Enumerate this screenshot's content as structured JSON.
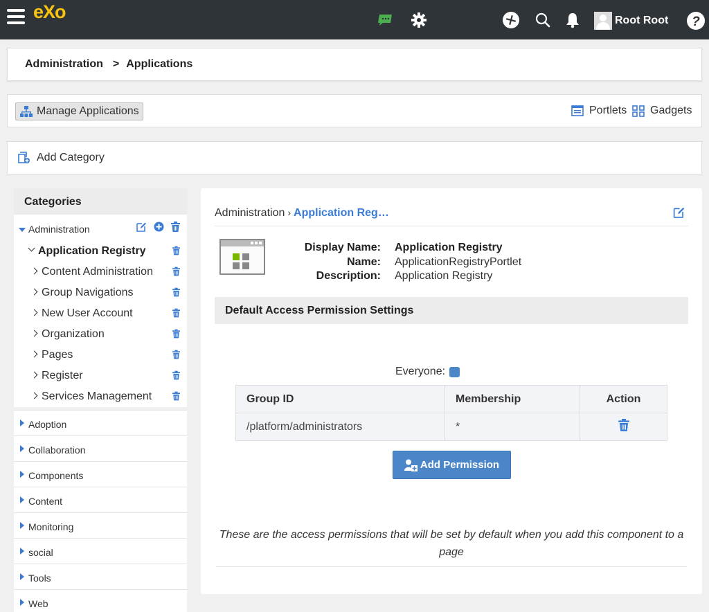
{
  "topbar": {
    "logo": "eXo",
    "user_name": "Root Root",
    "icons": [
      "menu-icon",
      "chat-icon",
      "settings-icon",
      "add-icon",
      "search-icon",
      "notification-icon",
      "help-icon"
    ]
  },
  "breadcrumb": {
    "first": "Administration",
    "separator": ">",
    "second": "Applications"
  },
  "toolbar": {
    "manage_label": "Manage Applications",
    "portlets_label": "Portlets",
    "gadgets_label": "Gadgets"
  },
  "add_category_label": "Add Category",
  "sidebar": {
    "title": "Categories",
    "open_category": "Administration",
    "items": [
      "Application Registry",
      "Content Administration",
      "Group Navigations",
      "New User Account",
      "Organization",
      "Pages",
      "Register",
      "Services Management"
    ],
    "closed_categories": [
      "Adoption",
      "Collaboration",
      "Components",
      "Content",
      "Monitoring",
      "social",
      "Tools",
      "Web"
    ]
  },
  "content": {
    "crumb_root": "Administration",
    "crumb_sep": "›",
    "crumb_current": "Application Reg…",
    "labels": {
      "display_name": "Display Name:",
      "name": "Name:",
      "description": "Description:"
    },
    "values": {
      "display_name": "Application Registry",
      "name": "ApplicationRegistryPortlet",
      "description": "Application Registry"
    },
    "section_title": "Default Access Permission Settings",
    "everyone_label": "Everyone:",
    "table": {
      "headers": [
        "Group ID",
        "Membership",
        "Action"
      ],
      "rows": [
        {
          "group_id": "/platform/administrators",
          "membership": "*"
        }
      ]
    },
    "add_permission_label": "Add Permission",
    "note": "These are the access permissions that will be set by default when you add this component to a page"
  },
  "colors": {
    "topbar_bg": "#2f3438",
    "logo": "#f9c310",
    "accent": "#3a7bd5",
    "button_primary": "#4a86c8",
    "chat_icon": "#4caf50"
  }
}
